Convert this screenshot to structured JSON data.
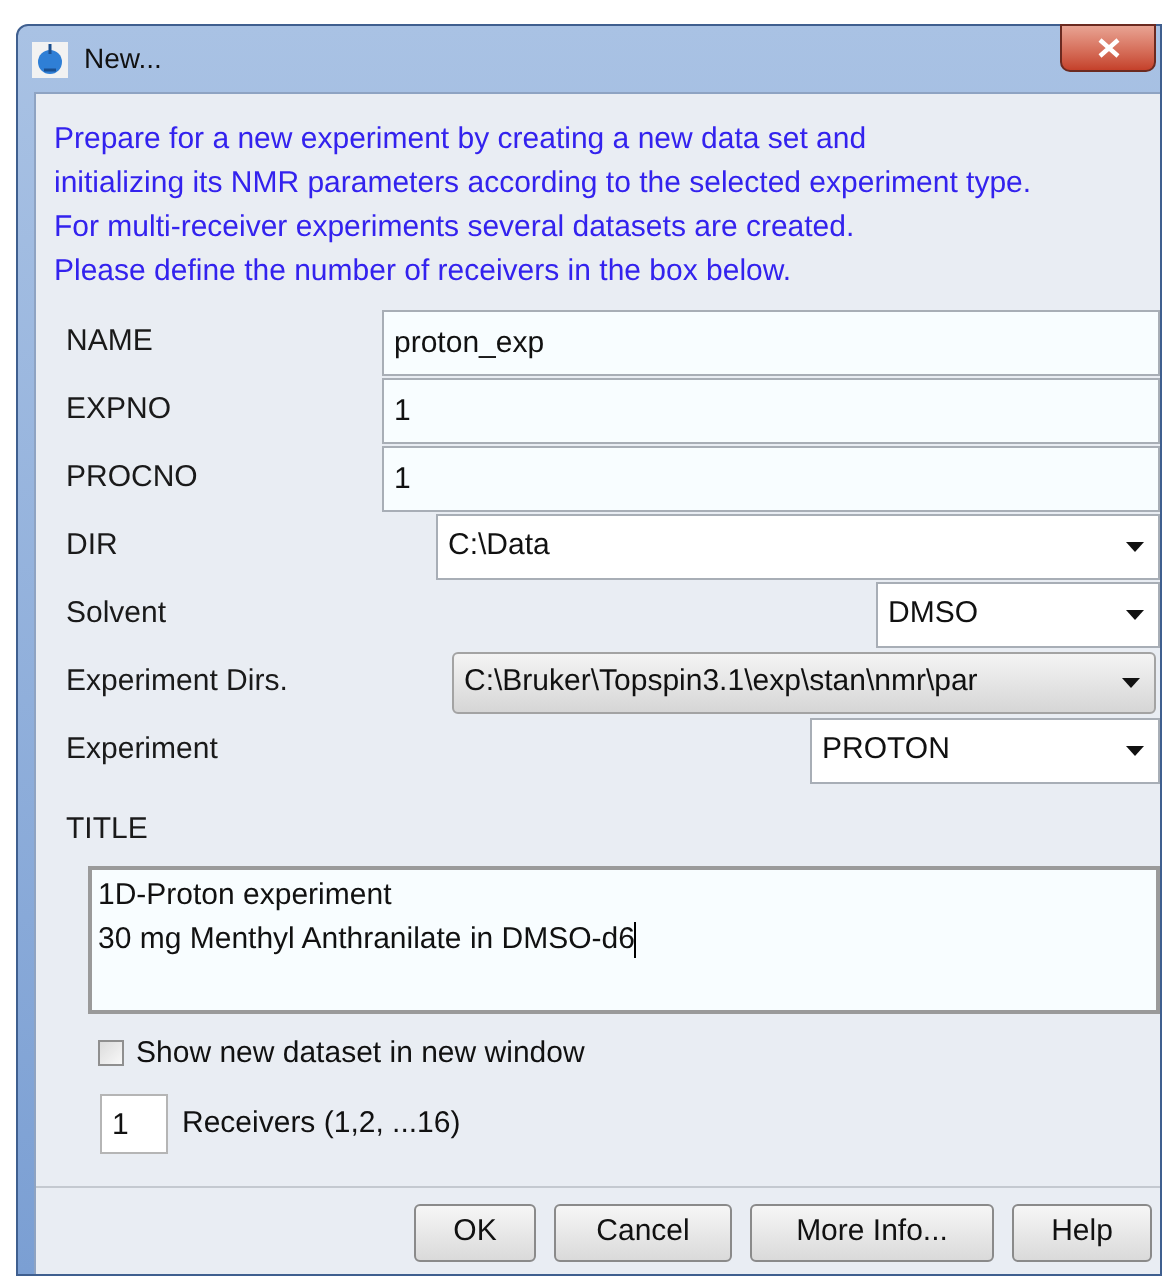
{
  "window": {
    "title": "New..."
  },
  "intro": [
    "Prepare for a new experiment by creating a new data set and",
    "initializing its NMR parameters according to the selected experiment type.",
    "For multi-receiver experiments several datasets are created.",
    "Please define the number of receivers in the box below."
  ],
  "fields": [
    {
      "kind": "text",
      "label": "NAME",
      "value": "proton_exp"
    },
    {
      "kind": "text",
      "label": "EXPNO",
      "value": "1"
    },
    {
      "kind": "text",
      "label": "PROCNO",
      "value": "1"
    },
    {
      "kind": "select",
      "label": "DIR",
      "value": "C:\\Data"
    },
    {
      "kind": "select",
      "label": "Solvent",
      "value": "DMSO"
    },
    {
      "kind": "combo",
      "label": "Experiment Dirs.",
      "value": "C:\\Bruker\\Topspin3.1\\exp\\stan\\nmr\\par"
    },
    {
      "kind": "select",
      "label": "Experiment",
      "value": "PROTON"
    }
  ],
  "title_field": {
    "label": "TITLE",
    "lines": [
      "1D-Proton experiment",
      "30 mg Menthyl Anthranilate in DMSO-d6"
    ]
  },
  "show_new_window": {
    "label": "Show new dataset in new window",
    "checked": false
  },
  "receivers": {
    "value": "1",
    "label": "Receivers (1,2, ...16)"
  },
  "buttons": [
    "OK",
    "Cancel",
    "More Info...",
    "Help"
  ]
}
